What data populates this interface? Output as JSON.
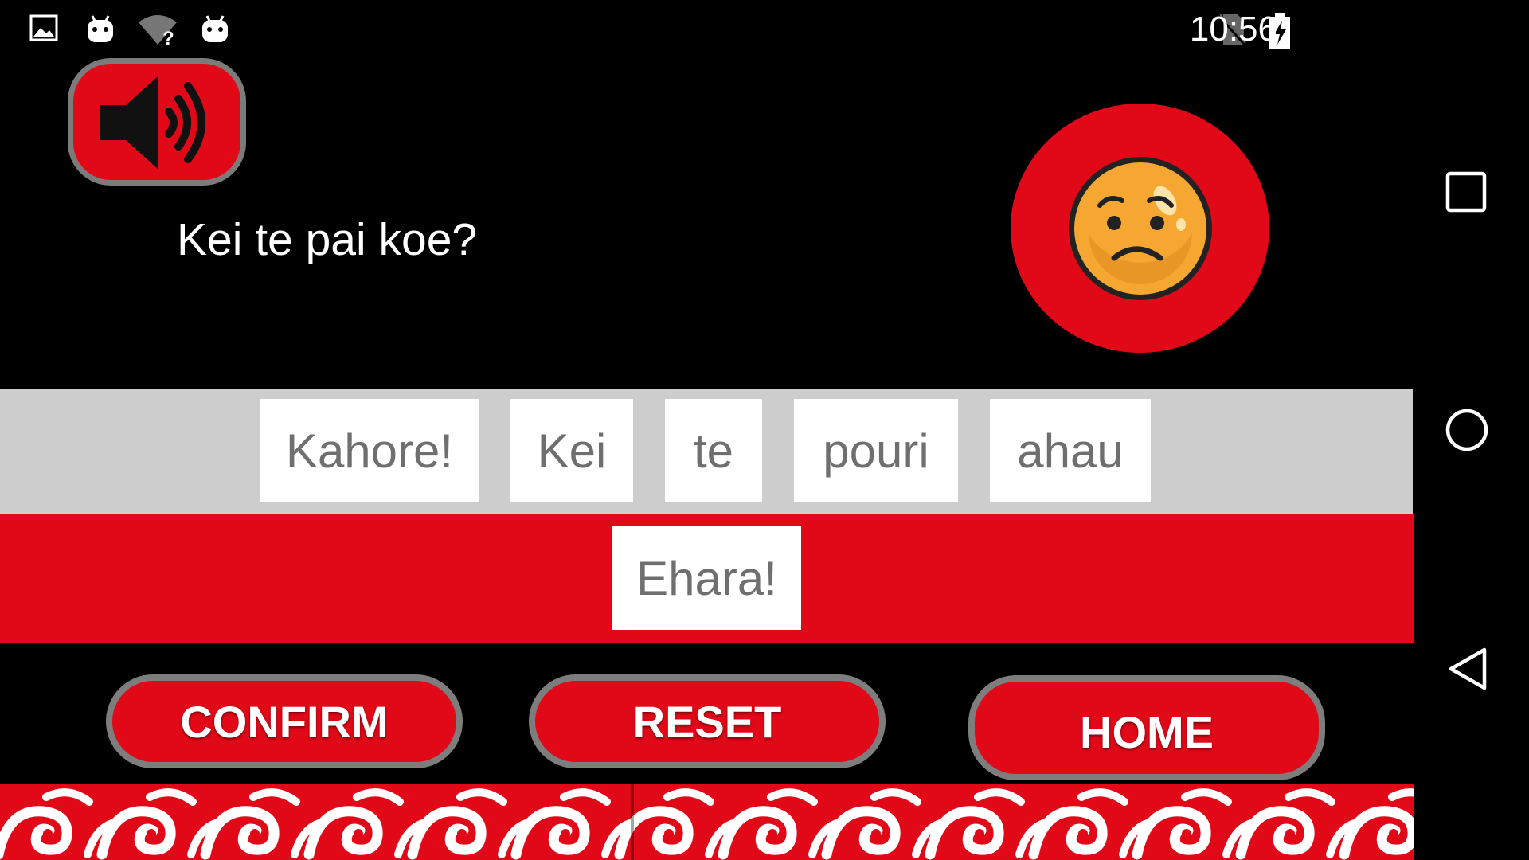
{
  "status_bar": {
    "time": "10:56",
    "icons": [
      "image-icon",
      "android-icon",
      "wifi-unknown-icon",
      "android-icon",
      "no-sim-icon",
      "battery-charging-icon"
    ]
  },
  "nav_bar": {
    "icons": [
      "recents-square-icon",
      "home-circle-icon",
      "back-triangle-icon"
    ]
  },
  "prompt": {
    "text": "Kei te pai koe?"
  },
  "emoji": {
    "name": "sad-face-icon"
  },
  "word_bank": {
    "tiles": [
      "Kahore!",
      "Kei",
      "te",
      "pouri",
      "ahau"
    ]
  },
  "answer": {
    "tiles": [
      "Ehara!"
    ]
  },
  "buttons": {
    "confirm": "CONFIRM",
    "reset": "RESET",
    "home": "HOME"
  },
  "colors": {
    "accent_red": "#e10818",
    "word_bank_bg": "#cdcdcd",
    "tile_text": "#6f6f6f",
    "button_border": "#7d7d7d"
  }
}
